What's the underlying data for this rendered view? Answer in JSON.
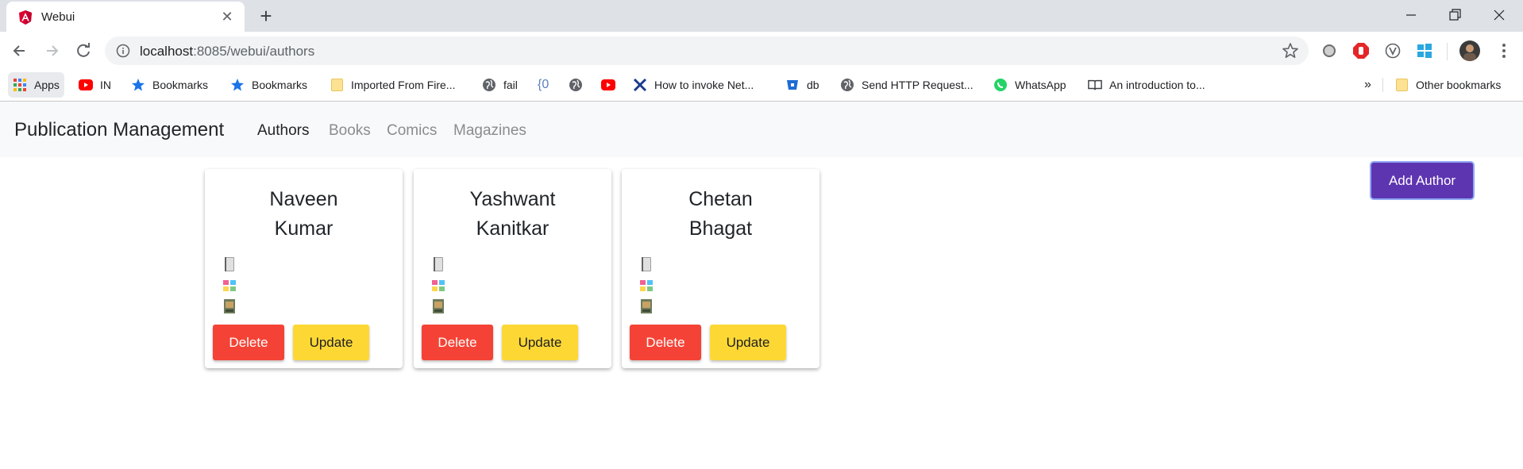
{
  "browser": {
    "tab_title": "Webui",
    "new_tab_label": "+",
    "url_host": "localhost",
    "url_rest": ":8085/webui/authors",
    "bookmarks": [
      {
        "label": "Apps",
        "icon": "apps-grid-icon"
      },
      {
        "label": "IN",
        "icon": "youtube-icon"
      },
      {
        "label": "Bookmarks",
        "icon": "star-icon"
      },
      {
        "label": "Bookmarks",
        "icon": "star-icon"
      },
      {
        "label": "Imported From Fire...",
        "icon": "folder-icon"
      },
      {
        "label": "fail",
        "icon": "globe-icon"
      },
      {
        "label": "{0",
        "icon": "code-icon"
      },
      {
        "label": "",
        "icon": "globe-icon"
      },
      {
        "label": "",
        "icon": "youtube-icon"
      },
      {
        "label": "How to invoke Net...",
        "icon": "x-logo-icon"
      },
      {
        "label": "db",
        "icon": "bitbucket-icon"
      },
      {
        "label": "Send HTTP Request...",
        "icon": "globe-icon"
      },
      {
        "label": "WhatsApp",
        "icon": "whatsapp-icon"
      },
      {
        "label": "An introduction to...",
        "icon": "book-icon"
      }
    ],
    "overflow_label": "»",
    "other_bookmarks_label": "Other bookmarks"
  },
  "app": {
    "brand": "Publication Management",
    "nav": [
      "Authors",
      "Books",
      "Comics",
      "Magazines"
    ],
    "active_nav": "Authors",
    "add_author_label": "Add Author"
  },
  "authors": [
    {
      "first": "Naveen",
      "last": "Kumar",
      "delete_label": "Delete",
      "update_label": "Update"
    },
    {
      "first": "Yashwant",
      "last": "Kanitkar",
      "delete_label": "Delete",
      "update_label": "Update"
    },
    {
      "first": "Chetan",
      "last": "Bhagat",
      "delete_label": "Delete",
      "update_label": "Update"
    }
  ],
  "colors": {
    "add_author": "#5e35b1",
    "delete": "#f44336",
    "update": "#fdd835"
  }
}
